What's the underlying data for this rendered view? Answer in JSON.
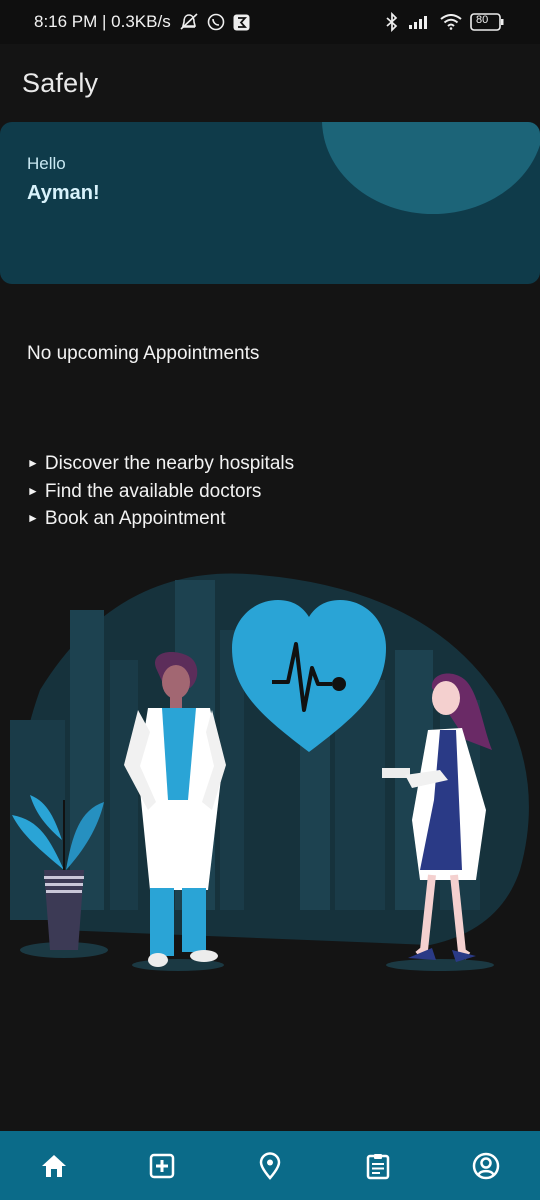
{
  "status_bar": {
    "time_network": "8:16 PM | 0.3KB/s",
    "battery": "80"
  },
  "app": {
    "title": "Safely"
  },
  "greeting": {
    "hello": "Hello",
    "name": "Ayman!"
  },
  "appointments": {
    "empty_text": "No upcoming Appointments"
  },
  "features": [
    "Discover the nearby hospitals",
    "Find the available doctors",
    "Book an Appointment"
  ],
  "bottom_nav": {
    "items": [
      {
        "icon": "home-icon",
        "active": true
      },
      {
        "icon": "medical-plus-icon"
      },
      {
        "icon": "location-pin-icon"
      },
      {
        "icon": "clipboard-icon"
      },
      {
        "icon": "profile-icon"
      }
    ]
  },
  "colors": {
    "background": "#141414",
    "card": "#0f3b4a",
    "accent": "#0b6b89",
    "heart": "#2aa4d6"
  }
}
